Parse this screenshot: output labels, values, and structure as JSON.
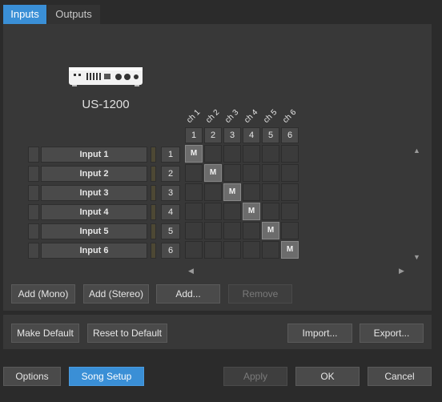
{
  "tabs": {
    "inputs": "Inputs",
    "outputs": "Outputs"
  },
  "device": {
    "name": "US-1200",
    "icon": "audio-interface-icon"
  },
  "channels": {
    "labels": [
      "ch 1",
      "ch 2",
      "ch 3",
      "ch 4",
      "ch 5",
      "ch 6"
    ],
    "numbers": [
      "1",
      "2",
      "3",
      "4",
      "5",
      "6"
    ]
  },
  "rows": [
    {
      "name": "Input 1",
      "num": "1",
      "mapped_channel": 1,
      "mark": "M"
    },
    {
      "name": "Input 2",
      "num": "2",
      "mapped_channel": 2,
      "mark": "M"
    },
    {
      "name": "Input 3",
      "num": "3",
      "mapped_channel": 3,
      "mark": "M"
    },
    {
      "name": "Input 4",
      "num": "4",
      "mapped_channel": 4,
      "mark": "M"
    },
    {
      "name": "Input 5",
      "num": "5",
      "mapped_channel": 5,
      "mark": "M"
    },
    {
      "name": "Input 6",
      "num": "6",
      "mapped_channel": 6,
      "mark": "M"
    }
  ],
  "scroll": {
    "up": "▲",
    "down": "▼",
    "left": "◀",
    "right": "▶"
  },
  "buttons": {
    "add_mono": "Add (Mono)",
    "add_stereo": "Add (Stereo)",
    "add": "Add...",
    "remove": "Remove",
    "make_default": "Make Default",
    "reset_default": "Reset to Default",
    "import": "Import...",
    "export": "Export...",
    "options": "Options",
    "song_setup": "Song Setup",
    "apply": "Apply",
    "ok": "OK",
    "cancel": "Cancel"
  },
  "colors": {
    "accent": "#3a8fd6",
    "background": "#2b2b2b",
    "panel": "#383838"
  }
}
